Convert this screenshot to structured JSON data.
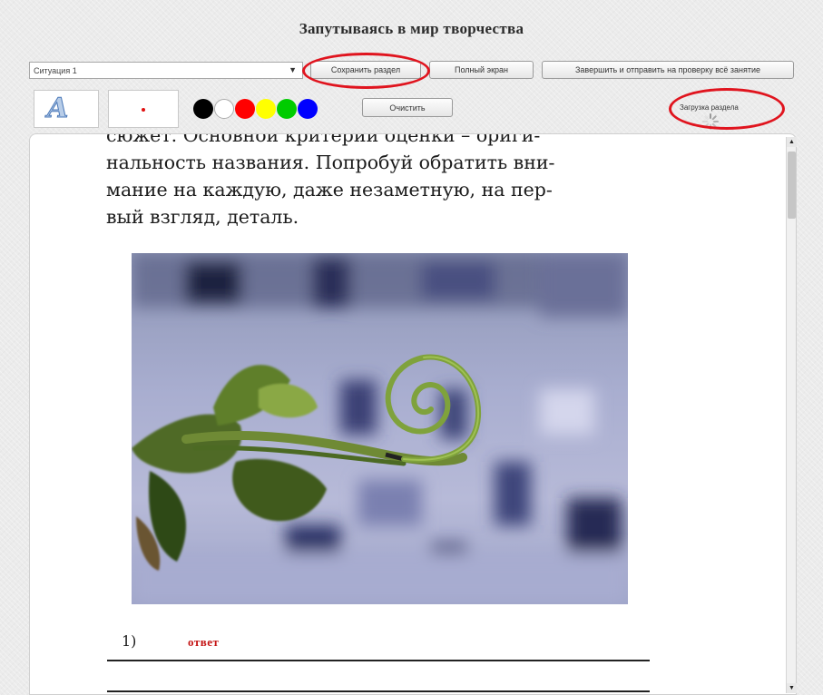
{
  "title": "Запутываясь в мир творчества",
  "toolbar": {
    "situation_select": "Ситуация 1",
    "save_section": "Сохранить раздел",
    "full_screen": "Полный экран",
    "finish_submit": "Завершить и отправить на проверку всё занятие",
    "clear": "Очистить",
    "loading_section": "Загрузка раздела"
  },
  "palette": {
    "colors": [
      "#000000",
      "#ffffff",
      "#ff0000",
      "#ffff00",
      "#00cc00",
      "#0000ff"
    ]
  },
  "content": {
    "lines": [
      "сюжет. Основной критерий оценки – ориги-",
      "нальность названия. Попробуй обратить вни-",
      "мание на каждую, даже незаметную, на пер-",
      "вый взгляд, деталь."
    ],
    "answer_number": "1)",
    "answer_label": "ответ"
  },
  "highlight_color": "#e0141e"
}
